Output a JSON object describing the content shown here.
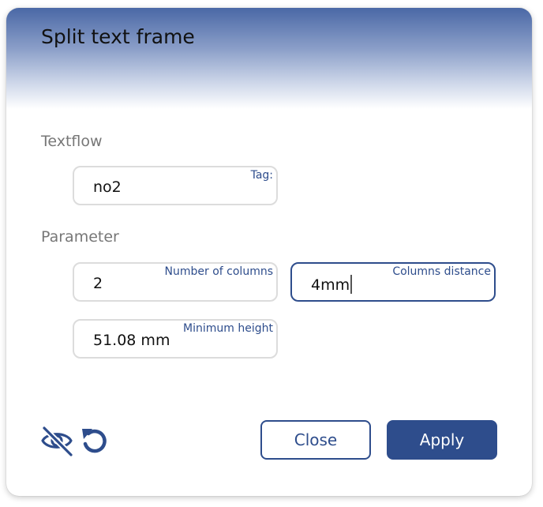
{
  "dialog": {
    "title": "Split text frame"
  },
  "sections": {
    "textflow": "Textflow",
    "parameter": "Parameter"
  },
  "fields": {
    "tag": {
      "label": "Tag:",
      "value": "no2"
    },
    "columns": {
      "label": "Number of columns",
      "value": "2"
    },
    "distance": {
      "label": "Columns distance",
      "value": "4mm"
    },
    "min_height": {
      "label": "Minimum height",
      "value": "51.08 mm"
    }
  },
  "buttons": {
    "close": "Close",
    "apply": "Apply"
  },
  "icons": {
    "visibility": "eye-off-icon",
    "reset": "reset-icon"
  },
  "colors": {
    "accent": "#2e4d8c",
    "header_top": "#4a68a6",
    "label_gray": "#777777",
    "field_border": "#dcdcdc"
  }
}
